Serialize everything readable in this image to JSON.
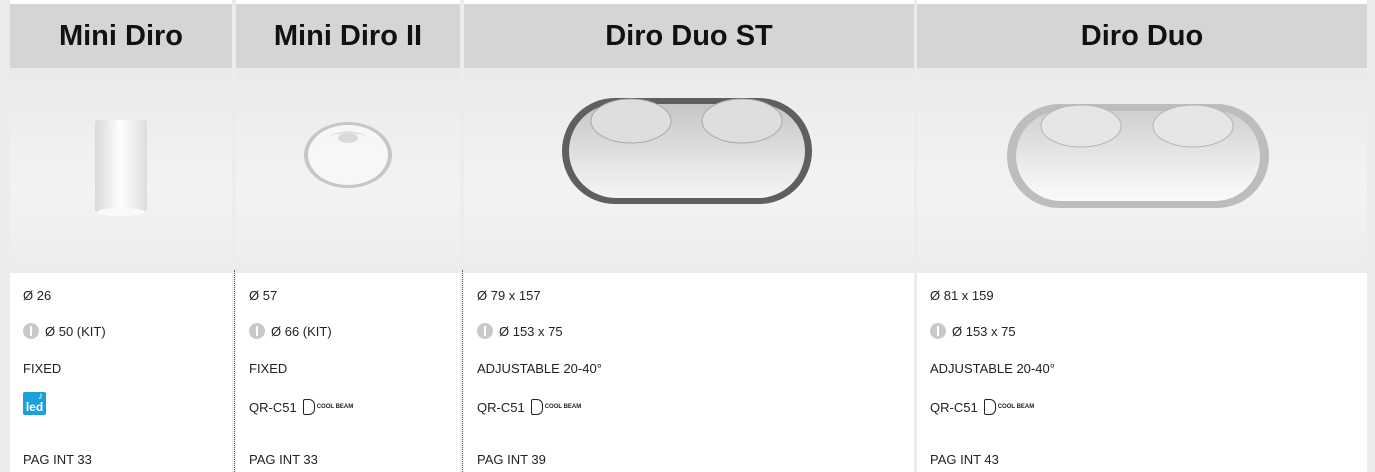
{
  "products": [
    {
      "name": "Mini Diro",
      "diameter": "Ø 26",
      "cutout": "Ø 50 (KIT)",
      "mount": "FIXED",
      "lamp": "",
      "lamp_icon": "led-icon",
      "page": "PAG INT 33"
    },
    {
      "name": "Mini Diro II",
      "diameter": "Ø 57",
      "cutout": "Ø 66 (KIT)",
      "mount": "FIXED",
      "lamp": "QR-C51",
      "lamp_icon": "cool-beam-lamp-icon",
      "page": "PAG INT 33"
    },
    {
      "name": "Diro Duo ST",
      "diameter": "Ø 79 x 157",
      "cutout": "Ø 153 x 75",
      "mount": "ADJUSTABLE 20-40°",
      "lamp": "QR-C51",
      "lamp_icon": "cool-beam-lamp-icon",
      "page": "PAG INT 39"
    },
    {
      "name": "Diro Duo",
      "diameter": "Ø 81 x 159",
      "cutout": "Ø 153 x 75",
      "mount": "ADJUSTABLE 20-40°",
      "lamp": "QR-C51",
      "lamp_icon": "cool-beam-lamp-icon",
      "page": "PAG INT 43"
    }
  ],
  "icons": {
    "cutout": "dimension-icon",
    "led_label": "led",
    "cool_beam_label": "COOL BEAM"
  },
  "colors": {
    "header_bg": "#d5d5d5",
    "background": "#ececec",
    "new_badge": "#e5175a",
    "led_blue": "#1aa0dc"
  }
}
